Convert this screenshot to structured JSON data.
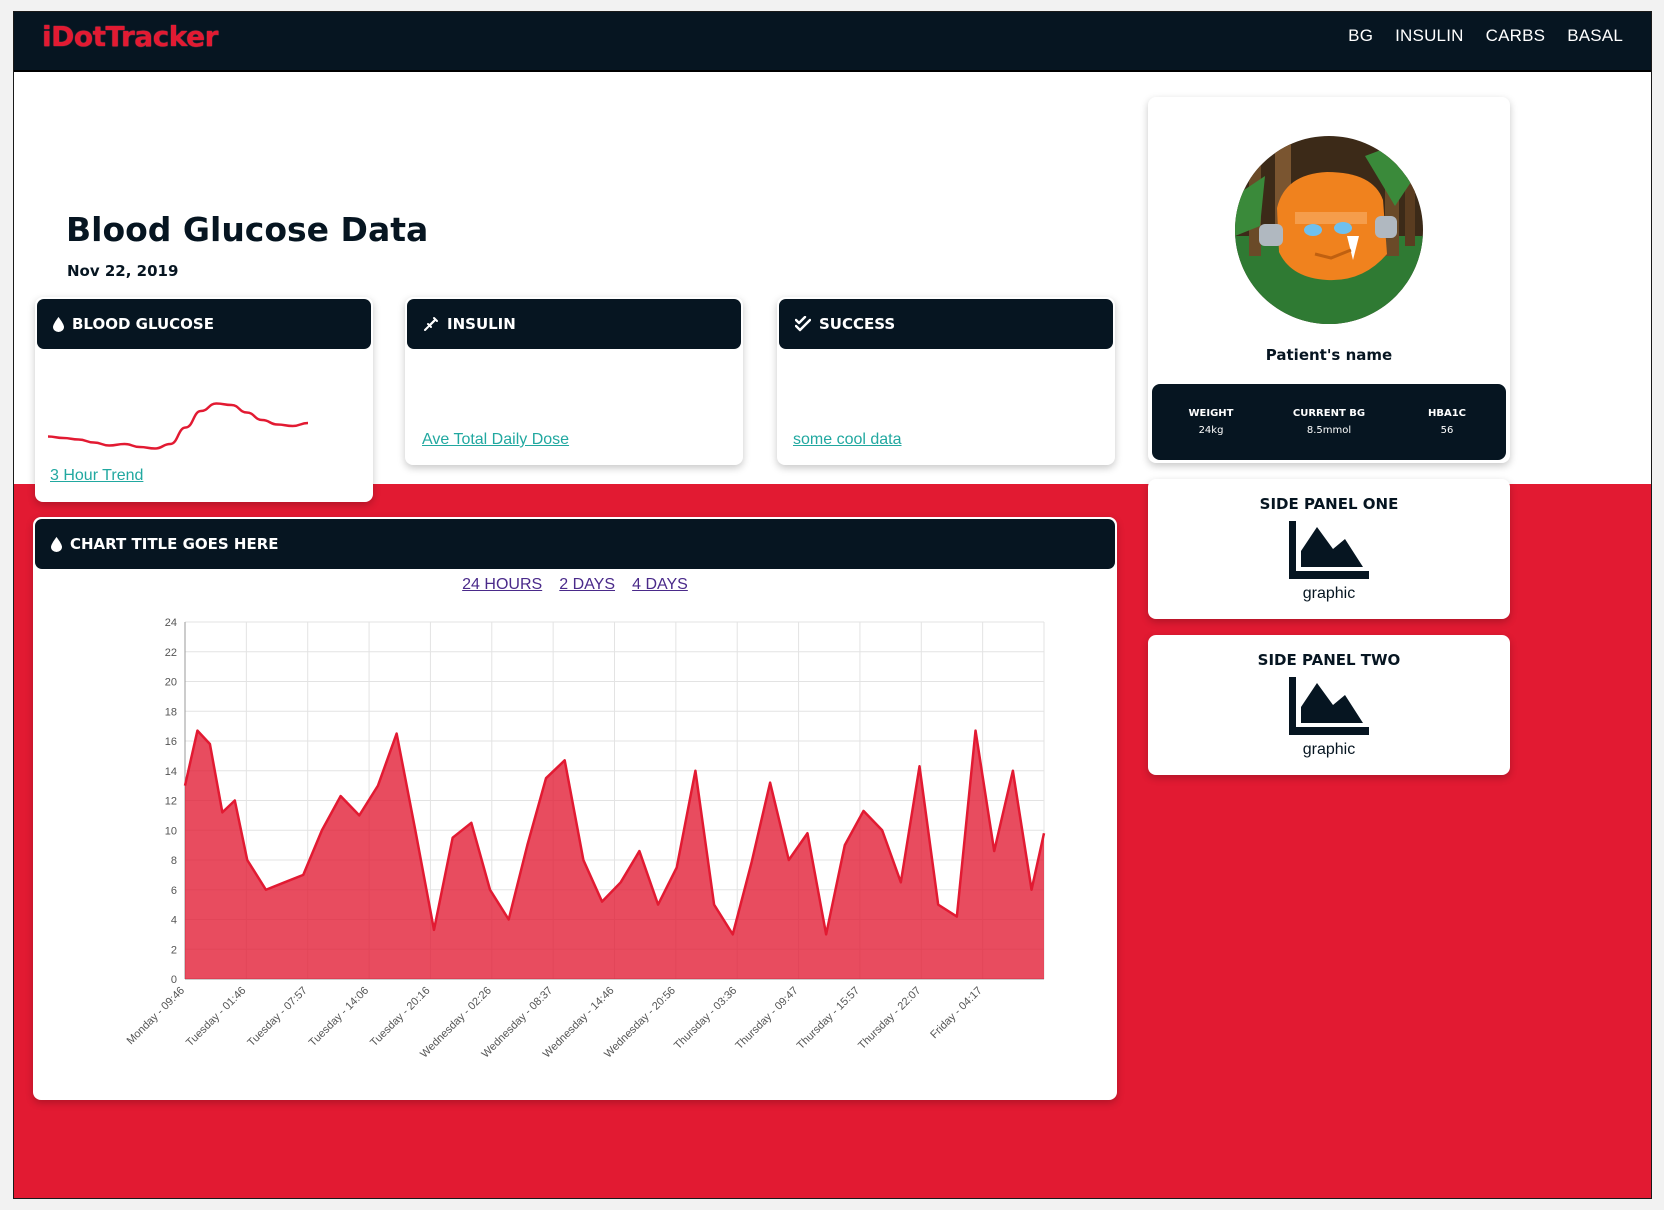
{
  "app": {
    "logo": "iDotTracker"
  },
  "nav": {
    "items": [
      "BG",
      "INSULIN",
      "CARBS",
      "BASAL"
    ]
  },
  "page": {
    "title": "Blood Glucose Data",
    "date": "Nov 22, 2019"
  },
  "cards": {
    "blood_glucose": {
      "title": "BLOOD GLUCOSE",
      "link": "3 Hour Trend",
      "icon": "droplet-icon"
    },
    "insulin": {
      "title": "INSULIN",
      "link": "Ave Total Daily Dose",
      "icon": "syringe-icon"
    },
    "success": {
      "title": "SUCCESS",
      "link": "some cool data",
      "icon": "double-check-icon"
    }
  },
  "chart_card": {
    "title": "CHART TITLE GOES HERE",
    "ranges": [
      "24 HOURS",
      "2 DAYS",
      "4 DAYS"
    ]
  },
  "profile": {
    "name": "Patient's name",
    "stats": [
      {
        "label": "WEIGHT",
        "value": "24kg"
      },
      {
        "label": "CURRENT BG",
        "value": "8.5mmol"
      },
      {
        "label": "HBA1C",
        "value": "56"
      }
    ]
  },
  "side_panels": [
    {
      "title": "SIDE PANEL ONE",
      "caption": "graphic",
      "icon": "area-chart-icon"
    },
    {
      "title": "SIDE PANEL TWO",
      "caption": "graphic",
      "icon": "area-chart-icon"
    }
  ],
  "colors": {
    "brand_red": "#e21a32",
    "navy": "#061521",
    "link_teal": "#21a8a0",
    "link_purple": "#4a2a8a"
  },
  "chart_data": [
    {
      "type": "line",
      "name": "sparkline",
      "values": [
        5.8,
        5.7,
        5.6,
        5.4,
        5.2,
        5.3,
        5.1,
        5.0,
        5.3,
        6.4,
        7.5,
        8.0,
        7.9,
        7.4,
        6.9,
        6.6,
        6.5,
        6.7
      ]
    },
    {
      "type": "area",
      "name": "blood-glucose",
      "ylim": [
        0,
        24
      ],
      "yticks": [
        0,
        2,
        4,
        6,
        8,
        10,
        12,
        14,
        16,
        18,
        20,
        22,
        24
      ],
      "xticks": [
        "Monday - 09:46",
        "Tuesday - 01:46",
        "Tuesday - 07:57",
        "Tuesday - 14:06",
        "Tuesday - 20:16",
        "Wednesday - 02:26",
        "Wednesday - 08:37",
        "Wednesday - 14:46",
        "Wednesday - 20:56",
        "Thursday - 03:36",
        "Thursday - 09:47",
        "Thursday - 15:57",
        "Thursday - 22:07",
        "Friday - 04:17"
      ],
      "grid": true,
      "x": [
        0.0,
        0.2,
        0.4,
        0.6,
        0.8,
        1.0,
        1.3,
        1.6,
        1.9,
        2.2,
        2.5,
        2.8,
        3.1,
        3.4,
        3.7,
        4.0,
        4.3,
        4.6,
        4.9,
        5.2,
        5.5,
        5.8,
        6.1,
        6.4,
        6.7,
        7.0,
        7.3,
        7.6,
        7.9,
        8.2,
        8.5,
        8.8,
        9.1,
        9.4,
        9.7,
        10.0,
        10.3,
        10.6,
        10.9,
        11.2,
        11.5,
        11.8,
        12.1,
        12.4,
        12.7,
        13.0,
        13.3,
        13.6,
        13.8
      ],
      "values": [
        13.0,
        16.7,
        15.8,
        11.2,
        12.0,
        8.0,
        6.0,
        6.5,
        7.0,
        10.0,
        12.3,
        11.0,
        13.0,
        16.5,
        10.0,
        3.3,
        9.5,
        10.5,
        6.0,
        4.0,
        9.0,
        13.5,
        14.7,
        8.0,
        5.2,
        6.5,
        8.6,
        5.0,
        7.5,
        14.0,
        5.0,
        3.0,
        7.8,
        13.2,
        8.0,
        9.8,
        3.0,
        9.0,
        11.3,
        10.0,
        6.5,
        14.3,
        5.0,
        4.2,
        16.7,
        8.6,
        14.0,
        6.0,
        9.8
      ]
    }
  ]
}
